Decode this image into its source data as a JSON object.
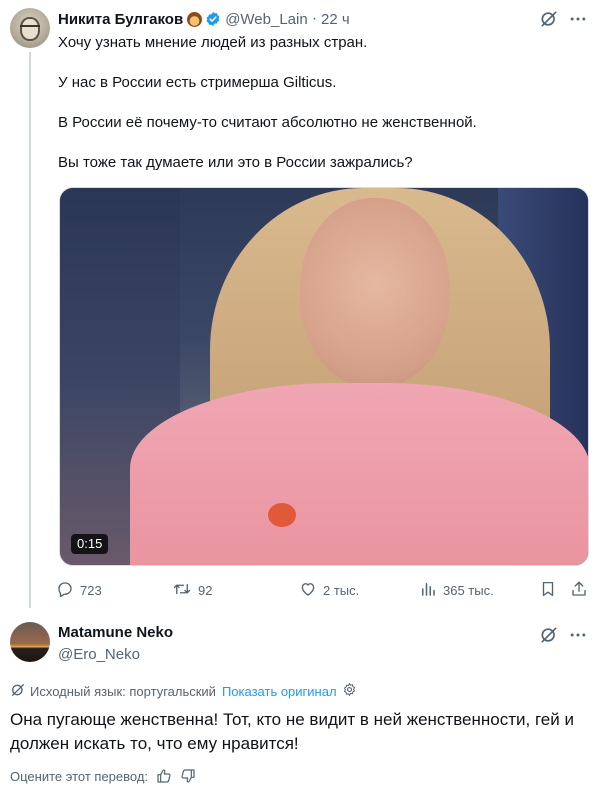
{
  "tweet": {
    "author_name": "Никита Булгаков",
    "handle": "@Web_Lain",
    "separator": "·",
    "time": "22 ч",
    "paragraphs": [
      "Хочу узнать мнение людей из разных стран.",
      "У нас в России есть стримерша Gilticus.",
      "В России её почему-то считают абсолютно не женственной.",
      "Вы тоже так думаете или это в России зажрались?"
    ],
    "video_duration": "0:15",
    "stats": {
      "replies": "723",
      "reposts": "92",
      "likes": "2 тыс.",
      "views": "365 тыс."
    }
  },
  "reply": {
    "author_name": "Matamune Neko",
    "handle": "@Ero_Neko",
    "source_language": "Исходный язык: португальский",
    "show_original": "Показать оригинал",
    "text": "Она пугающе женственна! Тот, кто не видит в ней женственности, гей и должен искать то, что ему нравится!",
    "rate_translation": "Оцените этот перевод:"
  },
  "colors": {
    "text": "#0f1419",
    "secondary": "#536471",
    "link": "#1d9bf0",
    "verified": "#1d9bf0",
    "thread_line": "#cfd9de"
  },
  "icons": [
    "grok-icon",
    "more-icon",
    "verified-icon",
    "reply-icon",
    "repost-icon",
    "like-icon",
    "views-icon",
    "bookmark-icon",
    "share-icon",
    "translate-icon",
    "settings-icon",
    "thumbs-up-icon",
    "thumbs-down-icon"
  ]
}
